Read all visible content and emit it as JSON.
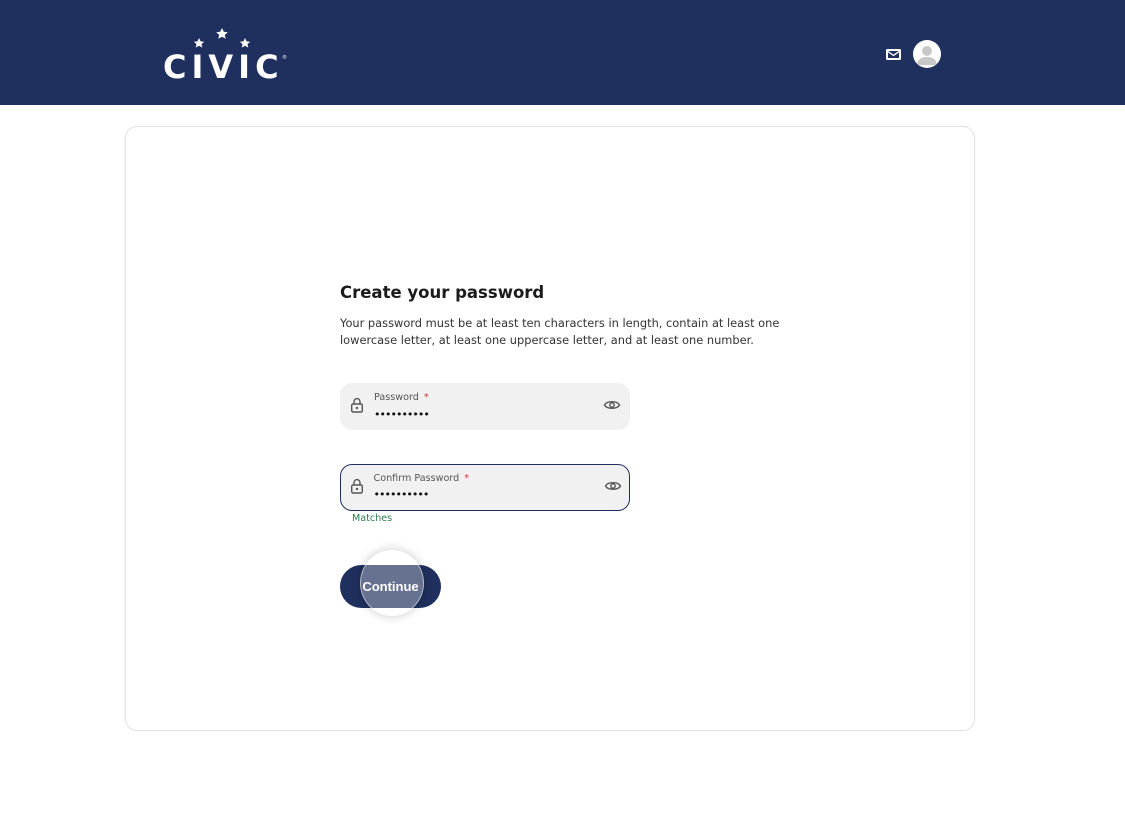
{
  "header": {
    "logo_text": "CIVIC",
    "mail_icon": "mail-icon",
    "avatar_icon": "user-avatar-icon"
  },
  "form": {
    "title": "Create your password",
    "description": "Your password must be at least ten characters in length, contain at least one lowercase letter, at least one uppercase letter, and at least one number.",
    "password": {
      "label": "Password",
      "required_mark": "*",
      "value": "••••••••••",
      "icon": "lock-icon",
      "toggle_icon": "eye-icon"
    },
    "confirm_password": {
      "label": "Confirm Password",
      "required_mark": "*",
      "value": "••••••••••",
      "icon": "lock-icon",
      "toggle_icon": "eye-icon",
      "status": "Matches"
    },
    "continue_label": "Continue"
  },
  "colors": {
    "brand_navy": "#20305e",
    "field_bg": "#f1f1f1",
    "required_red": "#d0342c",
    "success_green": "#2e7d4f"
  }
}
